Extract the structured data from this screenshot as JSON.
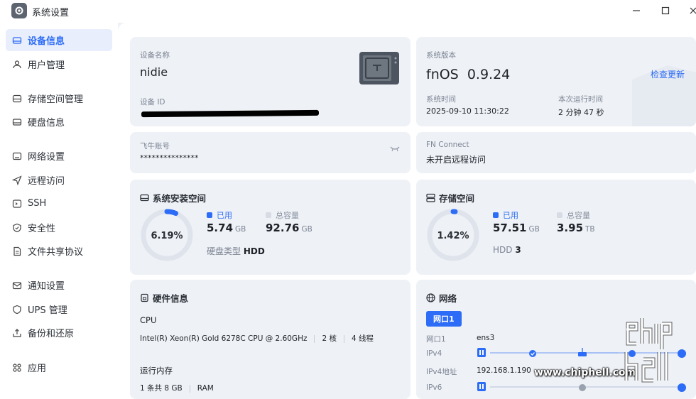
{
  "window": {
    "title": "系统设置"
  },
  "sidebar": {
    "items": [
      {
        "label": "设备信息"
      },
      {
        "label": "用户管理"
      },
      {
        "label": "存储空间管理"
      },
      {
        "label": "硬盘信息"
      },
      {
        "label": "网络设置"
      },
      {
        "label": "远程访问"
      },
      {
        "label": "SSH"
      },
      {
        "label": "安全性"
      },
      {
        "label": "文件共享协议"
      },
      {
        "label": "通知设置"
      },
      {
        "label": "UPS 管理"
      },
      {
        "label": "备份和还原"
      },
      {
        "label": "应用"
      }
    ]
  },
  "device": {
    "name_label": "设备名称",
    "name": "nidie",
    "id_label": "设备 ID"
  },
  "system": {
    "version_label": "系统版本",
    "version": "fnOS  0.9.24",
    "check_update": "检查更新",
    "time_label": "系统时间",
    "time": "2025-09-10 11:30:22",
    "uptime_label": "本次运行时间",
    "uptime": "2 分钟 47 秒"
  },
  "account": {
    "label": "飞牛账号",
    "value": "***************"
  },
  "fnconnect": {
    "label": "FN Connect",
    "value": "未开启远程访问"
  },
  "sys_space": {
    "title": "系统安装空间",
    "percent": "6.19%",
    "percent_value": 6.19,
    "used_label": "已用",
    "used": "5.74",
    "used_unit": "GB",
    "total_label": "总容量",
    "total": "92.76",
    "total_unit": "GB",
    "disk_type_label": "硬盘类型",
    "disk_type": "HDD"
  },
  "storage": {
    "title": "存储空间",
    "percent": "1.42%",
    "percent_value": 1.42,
    "used_label": "已用",
    "used": "57.51",
    "used_unit": "GB",
    "total_label": "总容量",
    "total": "3.95",
    "total_unit": "TB",
    "hdd_label": "HDD",
    "hdd_count": "3"
  },
  "hardware": {
    "title": "硬件信息",
    "cpu_label": "CPU",
    "cpu_model": "Intel(R) Xeon(R) Gold 6278C CPU @ 2.60GHz",
    "cores": "2 核",
    "threads": "4 线程",
    "mem_label": "运行内存",
    "mem_slots": "1 条共 8 GB",
    "mem_type": "RAM"
  },
  "network": {
    "title": "网络",
    "tab": "网口1",
    "port_label": "网口1",
    "port_value": "ens3",
    "ipv4_label": "IPv4",
    "ipv4_addr_label": "IPv4地址",
    "ipv4_addr": "192.168.1.190",
    "ipv6_label": "IPv6"
  },
  "watermark": {
    "url": "www.chiphell.com",
    "logo": "chip hell"
  },
  "colors": {
    "accent": "#2c6cf6",
    "ring_bg": "#dfe4ec",
    "card_bg": "#eef1f6"
  }
}
